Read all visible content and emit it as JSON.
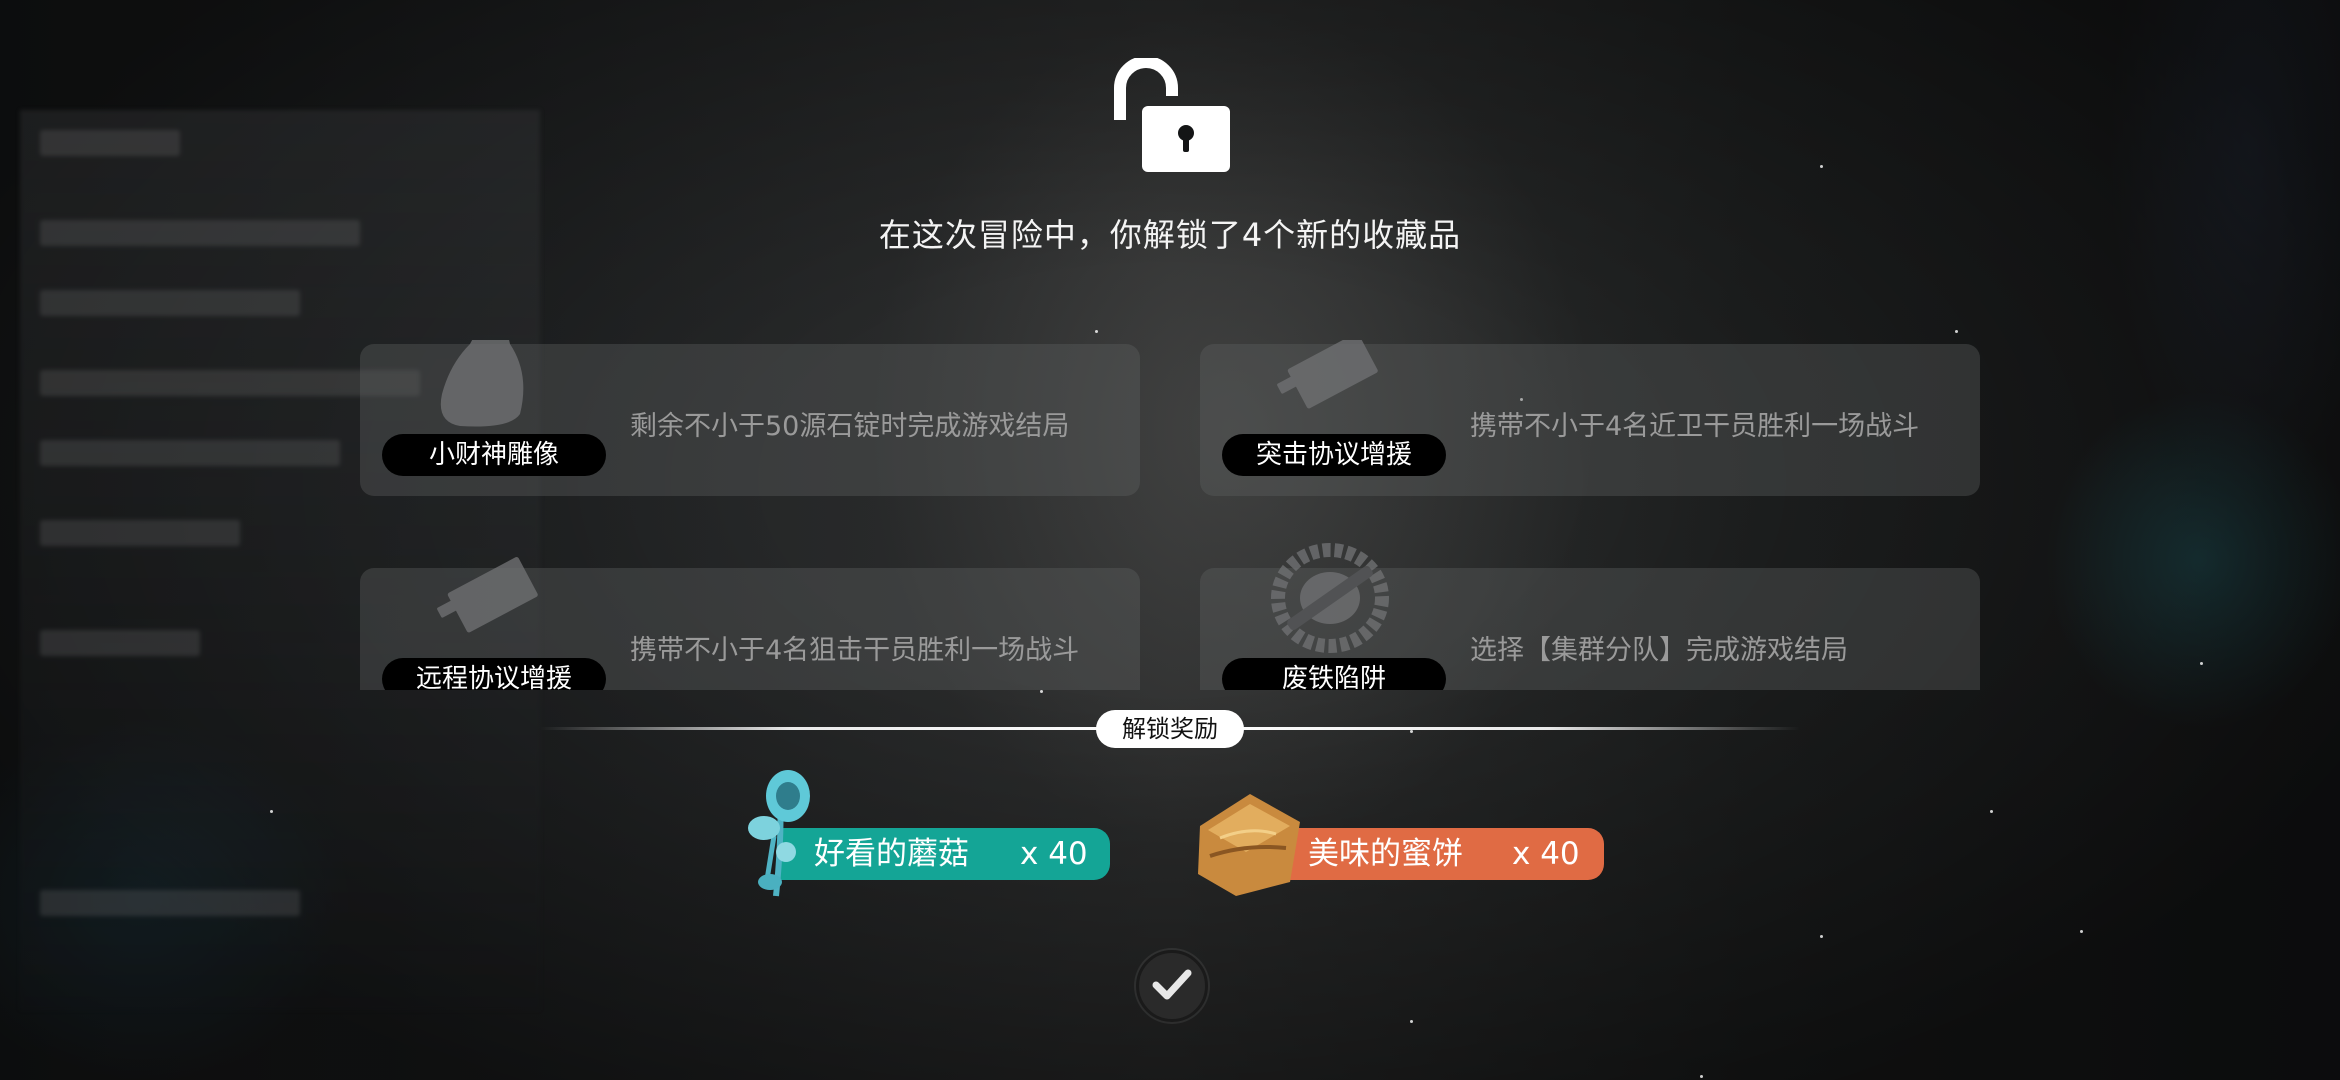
{
  "headline": "在这次冒险中，你解锁了4个新的收藏品",
  "collectibles": [
    {
      "name": "小财神雕像",
      "requirement": "剩余不小于50源石锭时完成游戏结局",
      "icon": "cat-statue-icon"
    },
    {
      "name": "突击协议增援",
      "requirement": "携带不小于4名近卫干员胜利一场战斗",
      "icon": "protocol-card-icon"
    },
    {
      "name": "远程协议增援",
      "requirement": "携带不小于4名狙击干员胜利一场战斗",
      "icon": "protocol-card-icon"
    },
    {
      "name": "废铁陷阱",
      "requirement": "选择【集群分队】完成游戏结局",
      "icon": "bear-trap-icon"
    }
  ],
  "reward_section": {
    "title": "解锁奖励",
    "items": [
      {
        "name": "好看的蘑菇",
        "quantity": "x 40",
        "color": "#14a596",
        "icon": "mushroom-icon"
      },
      {
        "name": "美味的蜜饼",
        "quantity": "x 40",
        "color": "#e06b44",
        "icon": "honey-cake-icon"
      }
    ]
  },
  "confirm_icon": "checkmark-icon"
}
